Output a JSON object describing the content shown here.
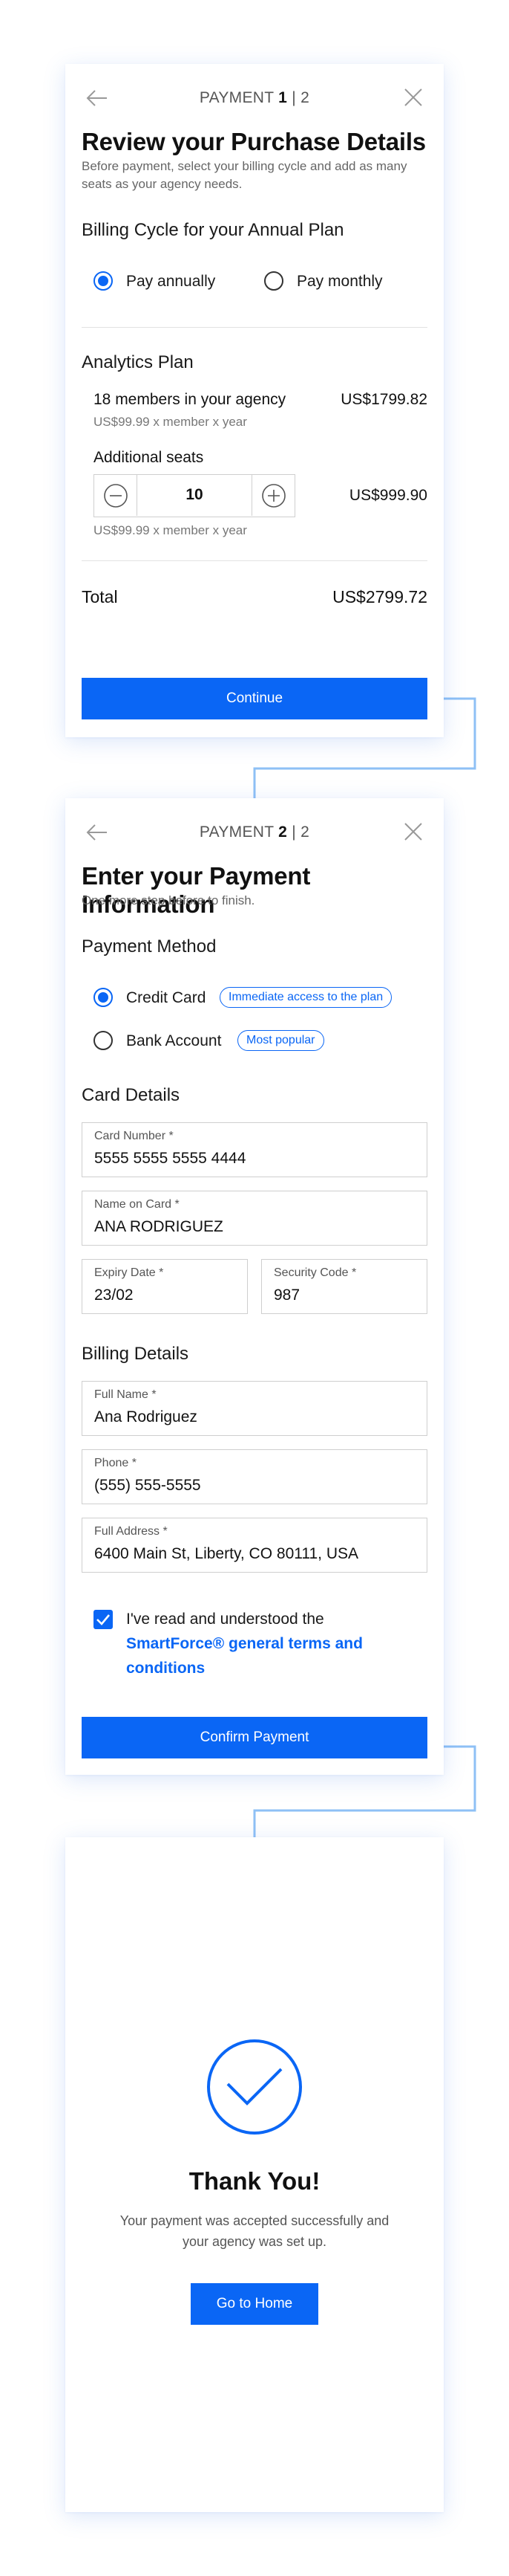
{
  "colors": {
    "accent": "#0a66f5",
    "text": "#111111",
    "muted": "#777777",
    "border": "#cfcfcf",
    "connector": "#8ec0f5"
  },
  "screen1": {
    "step_prefix": "PAYMENT",
    "step_current": "1",
    "step_suffix": "| 2",
    "title": "Review your Purchase Details",
    "subtitle": "Before payment, select your billing cycle and add as many seats as your agency needs.",
    "billing_heading": "Billing Cycle for your Annual Plan",
    "billing_options": [
      {
        "label": "Pay annually",
        "selected": true
      },
      {
        "label": "Pay monthly",
        "selected": false
      }
    ],
    "plan_heading": "Analytics Plan",
    "members_label": "18 members in your agency",
    "members_price": "US$1799.82",
    "members_rate": "US$99.99 x member x year",
    "seats_label": "Additional seats",
    "seats_value": "10",
    "seats_price": "US$999.90",
    "seats_rate": "US$99.99 x member x year",
    "total_label": "Total",
    "total_value": "US$2799.72",
    "continue_label": "Continue"
  },
  "screen2": {
    "step_prefix": "PAYMENT",
    "step_current": "2",
    "step_suffix": "| 2",
    "title": "Enter your Payment Information",
    "subtitle": "One more step before to finish.",
    "method_heading": "Payment Method",
    "methods": [
      {
        "label": "Credit Card",
        "badge": "Immediate access to the plan",
        "selected": true
      },
      {
        "label": "Bank Account",
        "badge": "Most popular",
        "selected": false
      }
    ],
    "card_heading": "Card Details",
    "card_number_label": "Card Number *",
    "card_number_value": "5555 5555 5555 4444",
    "name_label": "Name on Card *",
    "name_value": "ANA RODRIGUEZ",
    "expiry_label": "Expiry Date *",
    "expiry_value": "23/02",
    "cvc_label": "Security Code *",
    "cvc_value": "987",
    "billing_heading": "Billing Details",
    "full_name_label": "Full Name *",
    "full_name_value": "Ana Rodriguez",
    "phone_label": "Phone *",
    "phone_value": "(555) 555-5555",
    "address_label": "Full Address *",
    "address_value": "6400 Main St, Liberty, CO 80111, USA",
    "terms_checked": true,
    "terms_text": "I've read and understood the",
    "terms_link": "SmartForce® general terms and conditions",
    "confirm_label": "Confirm Payment"
  },
  "screen3": {
    "title": "Thank You!",
    "message": "Your payment was accepted successfully and your agency was set up.",
    "home_label": "Go to Home"
  }
}
